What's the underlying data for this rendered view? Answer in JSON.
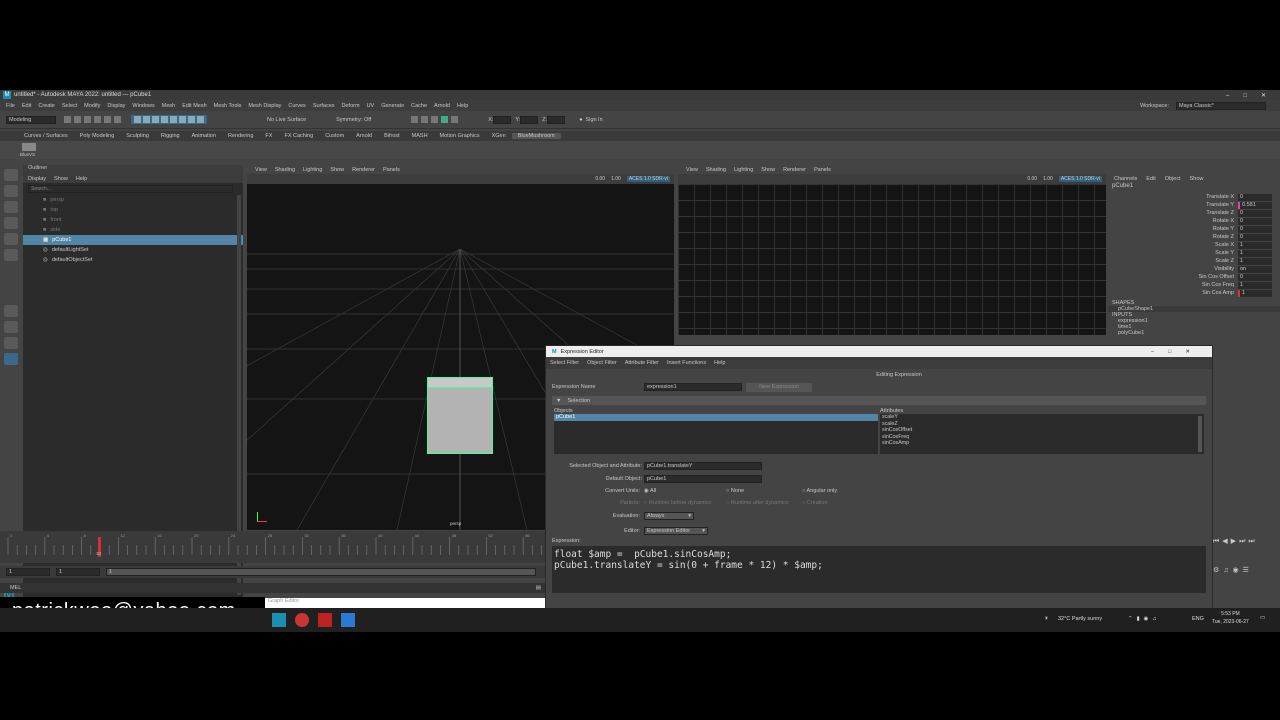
{
  "window": {
    "title": "untitled* - Autodesk MAYA 2022: untitled  ---  pCube1"
  },
  "menu": [
    "File",
    "Edit",
    "Create",
    "Select",
    "Modify",
    "Display",
    "Windows",
    "Mesh",
    "Edit Mesh",
    "Mesh Tools",
    "Mesh Display",
    "Curves",
    "Surfaces",
    "Deform",
    "UV",
    "Generate",
    "Cache",
    "Arnold",
    "Help"
  ],
  "workspace": {
    "label": "Workspace:",
    "value": "Maya Classic*"
  },
  "toolbar": {
    "mode": "Modeling",
    "live": "No Live Surface",
    "symmetry": "Symmetry: Off",
    "signin": "Sign In",
    "x": "X:",
    "y": "Y:",
    "z": "Z:"
  },
  "shelf_tabs": [
    "Curves / Surfaces",
    "Poly Modeling",
    "Sculpting",
    "Rigging",
    "Animation",
    "Rendering",
    "FX",
    "FX Caching",
    "Custom",
    "Arnold",
    "Bifrost",
    "MASH",
    "Motion Graphics",
    "XGen",
    "BlueMushroom"
  ],
  "shelf_item": "BlueVS",
  "outliner": {
    "title": "Outliner",
    "menu": [
      "Display",
      "Show",
      "Help"
    ],
    "search": "Search...",
    "items": [
      "persp",
      "top",
      "front",
      "side",
      "pCube1",
      "defaultLightSet",
      "defaultObjectSet"
    ]
  },
  "viewport_menu": [
    "View",
    "Shading",
    "Lighting",
    "Show",
    "Renderer",
    "Panels"
  ],
  "viewport": {
    "num1": "0.00",
    "num2": "1.00",
    "colorspace": "ACES 1.0 SDR-vi",
    "camera": "persp"
  },
  "channelbox": {
    "tabs": [
      "Channels",
      "Edit",
      "Object",
      "Show"
    ],
    "object": "pCube1",
    "attrs": [
      {
        "name": "Translate X",
        "value": "0"
      },
      {
        "name": "Translate Y",
        "value": "0.581"
      },
      {
        "name": "Translate Z",
        "value": "0"
      },
      {
        "name": "Rotate X",
        "value": "0"
      },
      {
        "name": "Rotate Y",
        "value": "0"
      },
      {
        "name": "Rotate Z",
        "value": "0"
      },
      {
        "name": "Scale X",
        "value": "1"
      },
      {
        "name": "Scale Y",
        "value": "1"
      },
      {
        "name": "Scale Z",
        "value": "1"
      },
      {
        "name": "Visibility",
        "value": "on"
      },
      {
        "name": "Sin Cos Offset",
        "value": "0"
      },
      {
        "name": "Sin Cos Freq",
        "value": "1"
      },
      {
        "name": "Sin Cos Amp",
        "value": "1"
      }
    ],
    "shapes_label": "SHAPES",
    "shape": "pCubeShape1",
    "inputs_label": "INPUTS",
    "inputs": [
      "expression1",
      "time1",
      "polyCube1"
    ]
  },
  "ee": {
    "title": "Expression Editor",
    "menu": [
      "Select Filter",
      "Object Filter",
      "Attribute Filter",
      "Insert Functions",
      "Help"
    ],
    "editing": "Editing Expression",
    "name_label": "Expression Name",
    "name_value": "expression1",
    "new_btn": "New Expression",
    "selection": "Selection",
    "objects_label": "Objects",
    "attributes_label": "Attributes",
    "object": "pCube1",
    "attributes": [
      "scaleY",
      "scaleZ",
      "sinCosOffset",
      "sinCosFreq",
      "sinCosAmp"
    ],
    "sel_label": "Selected Object and Attribute:",
    "sel_value": "pCube1.translateY",
    "default_label": "Default Object:",
    "default_value": "pCube1",
    "convert_label": "Convert Units:",
    "convert_opts": [
      "All",
      "None",
      "Angular only"
    ],
    "particle_label": "Particle:",
    "particle_opts": [
      "Runtime before dynamics",
      "Runtime after dynamics",
      "Creation"
    ],
    "eval_label": "Evaluation:",
    "eval_value": "Always",
    "editor_label": "Editor:",
    "editor_value": "Expression Editor",
    "expr_label": "Expression:",
    "code1": "float $amp =  pCube1.sinCosAmp;",
    "code2": "pCube1.translateY = sin(0 + frame * 12) * $amp;"
  },
  "timeline": {
    "start": "1",
    "start2": "1",
    "range": "1",
    "frame": "10",
    "ticks": [
      "1",
      "4",
      "8",
      "12",
      "16",
      "20",
      "24",
      "28",
      "32",
      "36",
      "40",
      "44",
      "48",
      "52",
      "56"
    ]
  },
  "cmd": {
    "label": "MEL",
    "graph": "Graph Editor"
  },
  "email": "patrickwoo@yahoo.com",
  "taskbar": {
    "weather": "32°C  Partly sunny",
    "lang": "ENG",
    "time": "5:53 PM",
    "date": "Tue, 2023-06-27"
  }
}
